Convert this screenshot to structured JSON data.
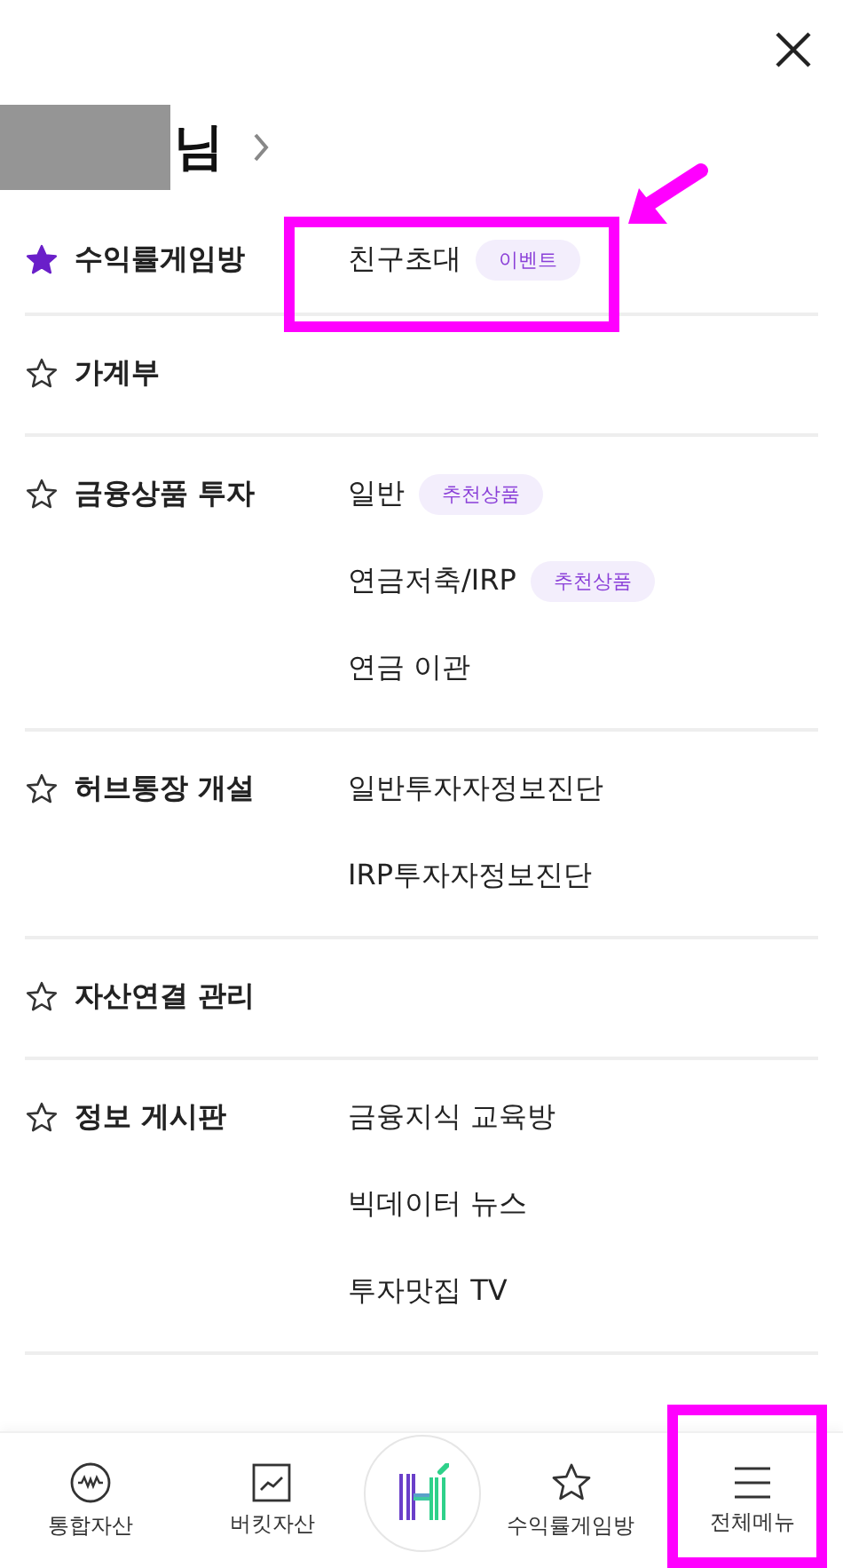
{
  "header": {
    "greeting": "님"
  },
  "sections": [
    {
      "title": "수익률게임방",
      "favorite": true,
      "items": [
        {
          "label": "친구초대",
          "badge": "이벤트"
        }
      ]
    },
    {
      "title": "가계부",
      "favorite": false
    },
    {
      "title": "금융상품 투자",
      "favorite": false,
      "items": [
        {
          "label": "일반",
          "badge": "추천상품"
        },
        {
          "label": "연금저축/IRP",
          "badge": "추천상품"
        },
        {
          "label": "연금 이관"
        }
      ]
    },
    {
      "title": "허브통장 개설",
      "favorite": false,
      "items": [
        {
          "label": "일반투자자정보진단"
        },
        {
          "label": "IRP투자자정보진단"
        }
      ]
    },
    {
      "title": "자산연결 관리",
      "favorite": false
    },
    {
      "title": "정보 게시판",
      "favorite": false,
      "items": [
        {
          "label": "금융지식 교육방"
        },
        {
          "label": "빅데이터 뉴스"
        },
        {
          "label": "투자맛집 TV"
        }
      ]
    }
  ],
  "bottom_nav": [
    {
      "kind": "gauge",
      "label": "통합자산"
    },
    {
      "kind": "chart",
      "label": "버킷자산"
    },
    {
      "kind": "logo"
    },
    {
      "kind": "star",
      "label": "수익률게임방"
    },
    {
      "kind": "menu",
      "label": "전체메뉴"
    }
  ]
}
